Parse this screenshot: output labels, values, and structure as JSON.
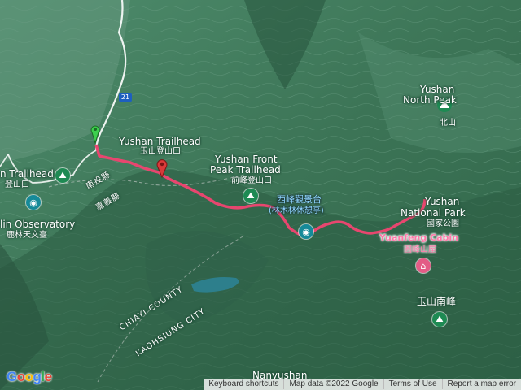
{
  "map": {
    "labels": {
      "yushan_trailhead_en": "Yushan Trailhead",
      "yushan_trailhead_zh": "玉山登山口",
      "front_peak_en_1": "Yushan Front",
      "front_peak_en_2": "Peak Trailhead",
      "front_peak_zh": "前峰登山口",
      "west_peak_zh_1": "西峰觀景台",
      "west_peak_zh_2": "(林木林休憩亭)",
      "yushan_np_en_1": "Yushan",
      "yushan_np_en_2": "National Park",
      "yushan_np_zh": "國家公園",
      "yuanfeng_en": "Yuanfeng Cabin",
      "yuanfeng_zh": "圓峰山屋",
      "north_peak_en": "Yushan",
      "north_peak_en_2": "North Peak",
      "north_peak_zh": "北山",
      "south_peak_zh": "玉山南峰",
      "left_trailhead_en": "n Trailhead",
      "left_trailhead_zh": "登山口",
      "observatory_en": "lin Observatory",
      "observatory_zh": "鹿林天文臺",
      "nantou": "南投縣",
      "chiayi": "嘉義縣",
      "chiayi_county": "CHIAYI COUNTY",
      "kaohsiung_city": "KAOHSIUNG CITY",
      "nanyushan": "Nanyushan",
      "route_shield": "21"
    },
    "footer": {
      "keyboard": "Keyboard shortcuts",
      "map_data": "Map data ©2022 Google",
      "terms": "Terms of Use",
      "report": "Report a map error"
    },
    "logo": "Google",
    "colors": {
      "route": "#e8466f",
      "road": "#ffffff",
      "start_marker": "#3ccf4e",
      "end_marker": "#d93a3a"
    }
  }
}
